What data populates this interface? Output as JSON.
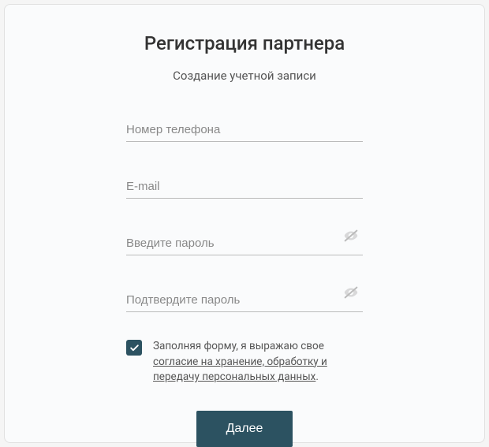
{
  "header": {
    "title": "Регистрация партнера",
    "subtitle": "Создание учетной записи"
  },
  "fields": {
    "phone": {
      "placeholder": "Номер телефона",
      "value": ""
    },
    "email": {
      "placeholder": "E-mail",
      "value": ""
    },
    "password": {
      "placeholder": "Введите пароль",
      "value": ""
    },
    "password_confirm": {
      "placeholder": "Подтвердите пароль",
      "value": ""
    }
  },
  "consent": {
    "checked": true,
    "text_prefix": "Заполняя форму, я выражаю свое ",
    "link_text": "согласие на хранение, обработку и передачу персональных данных",
    "text_suffix": "."
  },
  "actions": {
    "submit_label": "Далее"
  }
}
